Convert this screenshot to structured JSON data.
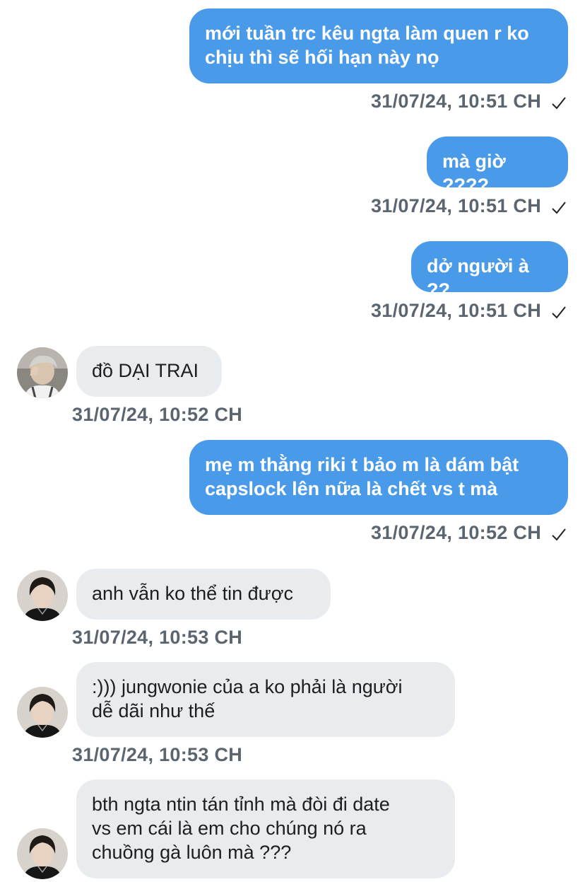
{
  "messages": [
    {
      "side": "out",
      "text": "mới tuần trc kêu ngta làm quen r ko\nchịu thì sẽ hối hạn này nọ",
      "time": "31/07/24, 10:51 CH"
    },
    {
      "side": "out",
      "text": "mà giờ ????",
      "time": "31/07/24, 10:51 CH"
    },
    {
      "side": "out",
      "text": "dở người à ??",
      "time": "31/07/24, 10:51 CH"
    },
    {
      "side": "in",
      "text": "đồ DẠI TRAI",
      "time": "31/07/24, 10:52 CH",
      "avatar": "avatar-grey-hair"
    },
    {
      "side": "out",
      "text": "mẹ m thằng riki t bảo m là dám bật\ncapslock lên nữa là chết vs t mà",
      "time": "31/07/24, 10:52 CH"
    },
    {
      "side": "in",
      "text": "anh vẫn ko thể tin được",
      "time": "31/07/24, 10:53 CH",
      "avatar": "avatar-dark-hair"
    },
    {
      "side": "in",
      "text": ":))) jungwonie của a ko phải là người\ndễ dãi như thế",
      "time": "31/07/24, 10:53 CH",
      "avatar": "avatar-dark-hair"
    },
    {
      "side": "in",
      "text": "bth ngta ntin tán tỉnh mà đòi đi date\nvs em cái là em cho chúng nó ra\nchuồng gà luôn mà ???",
      "time": "",
      "avatar": "avatar-dark-hair"
    }
  ],
  "status_icon": "checkmark-icon",
  "colors": {
    "outgoing_bubble": "#4a9aea",
    "incoming_bubble": "#e9ecef",
    "timestamp": "#5b6570"
  }
}
